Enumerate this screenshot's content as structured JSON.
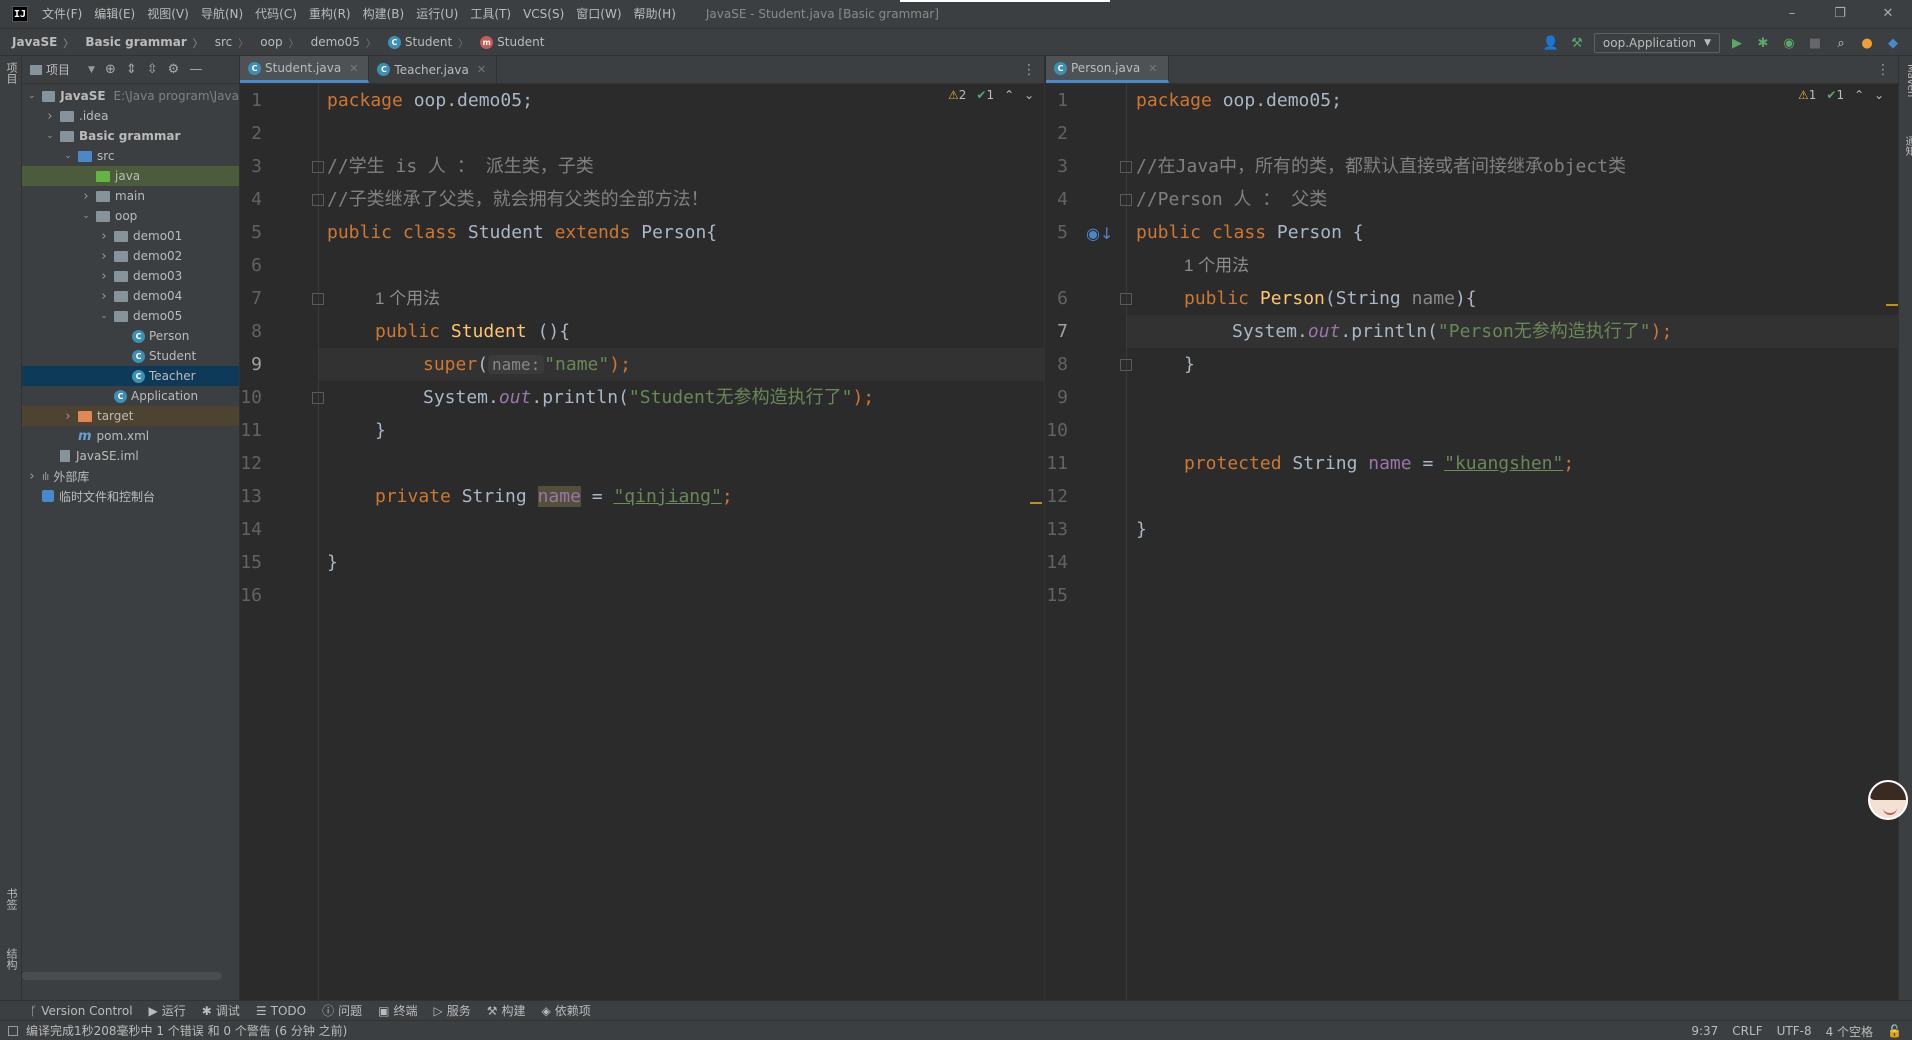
{
  "menu": {
    "items": [
      "文件(F)",
      "编辑(E)",
      "视图(V)",
      "导航(N)",
      "代码(C)",
      "重构(R)",
      "构建(B)",
      "运行(U)",
      "工具(T)",
      "VCS(S)",
      "窗口(W)",
      "帮助(H)"
    ],
    "window_title": "JavaSE - Student.java [Basic grammar]"
  },
  "breadcrumb": [
    "JavaSE",
    "Basic grammar",
    "src",
    "oop",
    "demo05",
    "Student",
    "Student"
  ],
  "toolbar": {
    "run_config": "oop.Application"
  },
  "side_strips": {
    "left_top": "项目",
    "left_bottom_1": "书签",
    "left_bottom_2": "结构",
    "right_1": "Maven",
    "right_2": "通知"
  },
  "project": {
    "title": "项目",
    "tree": [
      {
        "label": "JavaSE",
        "extra": "E:\\Java program\\Java",
        "depth": 0,
        "icon": "proj",
        "chev": "down",
        "bold": true
      },
      {
        "label": ".idea",
        "depth": 1,
        "icon": "folder",
        "chev": "right"
      },
      {
        "label": "Basic grammar",
        "depth": 1,
        "icon": "proj",
        "chev": "down",
        "bold": true
      },
      {
        "label": "src",
        "depth": 2,
        "icon": "blue",
        "chev": "down"
      },
      {
        "label": "java",
        "depth": 3,
        "icon": "green",
        "chev": "",
        "row": "sel-java"
      },
      {
        "label": "main",
        "depth": 3,
        "icon": "folder",
        "chev": "right"
      },
      {
        "label": "oop",
        "depth": 3,
        "icon": "folder",
        "chev": "down"
      },
      {
        "label": "demo01",
        "depth": 4,
        "icon": "folder",
        "chev": "right"
      },
      {
        "label": "demo02",
        "depth": 4,
        "icon": "folder",
        "chev": "right"
      },
      {
        "label": "demo03",
        "depth": 4,
        "icon": "folder",
        "chev": "right"
      },
      {
        "label": "demo04",
        "depth": 4,
        "icon": "folder",
        "chev": "right"
      },
      {
        "label": "demo05",
        "depth": 4,
        "icon": "folder",
        "chev": "down"
      },
      {
        "label": "Person",
        "depth": 5,
        "icon": "class",
        "chev": ""
      },
      {
        "label": "Student",
        "depth": 5,
        "icon": "class",
        "chev": ""
      },
      {
        "label": "Teacher",
        "depth": 5,
        "icon": "class",
        "chev": "",
        "row": "sel-teacher"
      },
      {
        "label": "Application",
        "depth": 4,
        "icon": "class",
        "chev": ""
      },
      {
        "label": "target",
        "depth": 2,
        "icon": "orange",
        "chev": "right",
        "row": "target-row"
      },
      {
        "label": "pom.xml",
        "depth": 2,
        "icon": "maven",
        "chev": ""
      },
      {
        "label": "JavaSE.iml",
        "depth": 1,
        "icon": "iml",
        "chev": ""
      },
      {
        "label": "外部库",
        "depth": 0,
        "icon": "lib",
        "chev": "right"
      },
      {
        "label": "临时文件和控制台",
        "depth": 0,
        "icon": "scratch",
        "chev": ""
      }
    ]
  },
  "editor_left": {
    "tabs": [
      {
        "label": "Student.java",
        "active": true
      },
      {
        "label": "Teacher.java",
        "active": false
      }
    ],
    "warnings": "2",
    "ok": "1",
    "current_line": "9",
    "line_numbers": [
      "1",
      "2",
      "3",
      "4",
      "5",
      "6",
      "7",
      "8",
      "9",
      "10",
      "11",
      "12",
      "13",
      "14",
      "15",
      "16"
    ],
    "code": {
      "l1_kw": "package",
      "l1_rest": " oop.demo05;",
      "l3": "//学生 is 人 ： 派生类，子类",
      "l4": "//子类继承了父类，就会拥有父类的全部方法！",
      "l5_kw": "public class",
      "l5_name": " Student ",
      "l5_kw2": "extends",
      "l5_rest": " Person{",
      "usage": "1 个用法",
      "l7_kw": "public",
      "l7_fn": " Student",
      "l7_rest": " (){",
      "l8_kw": "super",
      "l8_open": "(",
      "l8_hint": "name:",
      "l8_str": "\"name\"",
      "l8_close": ");",
      "l9_a": "System.",
      "l9_out": "out",
      "l9_b": ".println(",
      "l9_str": "\"Student无参构造执行了\"",
      "l9_c": ");",
      "l10": "}",
      "l12_kw": "private",
      "l12_type": " String ",
      "l12_field": "name",
      "l12_eq": " = ",
      "l12_str": "\"qinjiang\"",
      "l12_end": ";",
      "l14": "}"
    }
  },
  "editor_right": {
    "tabs": [
      {
        "label": "Person.java",
        "active": true
      }
    ],
    "warnings": "1",
    "ok": "1",
    "current_line": "7",
    "line_numbers": [
      "1",
      "2",
      "3",
      "4",
      "5",
      "",
      "6",
      "7",
      "8",
      "9",
      "10",
      "11",
      "12",
      "13",
      "14",
      "15"
    ],
    "code": {
      "l1_kw": "package",
      "l1_rest": " oop.demo05;",
      "l3": "//在Java中，所有的类，都默认直接或者间接继承object类",
      "l4": "//Person 人 ： 父类",
      "l5_kw": "public class",
      "l5_rest": " Person {",
      "usage": "1 个用法",
      "l6_kw": "public",
      "l6_fn": " Person",
      "l6_open": "(String ",
      "l6_param": "name",
      "l6_close": "){",
      "l7_a": "System.",
      "l7_out": "out",
      "l7_b": ".println(",
      "l7_str": "\"Person无参构造执行了\"",
      "l7_c": ");",
      "l8": "}",
      "l11_kw": "protected",
      "l11_type": " String ",
      "l11_field": "name",
      "l11_eq": " = ",
      "l11_str": "\"kuangshen\"",
      "l11_end": ";",
      "l13": "}"
    }
  },
  "bottom_tools": [
    "Version Control",
    "运行",
    "调试",
    "TODO",
    "问题",
    "终端",
    "服务",
    "构建",
    "依赖项"
  ],
  "status": {
    "message": "编译完成1秒208毫秒中 1 个错误 和 0 个警告 (6 分钟 之前)",
    "position": "9:37",
    "line_sep": "CRLF",
    "encoding": "UTF-8",
    "indent": "4 个空格"
  }
}
